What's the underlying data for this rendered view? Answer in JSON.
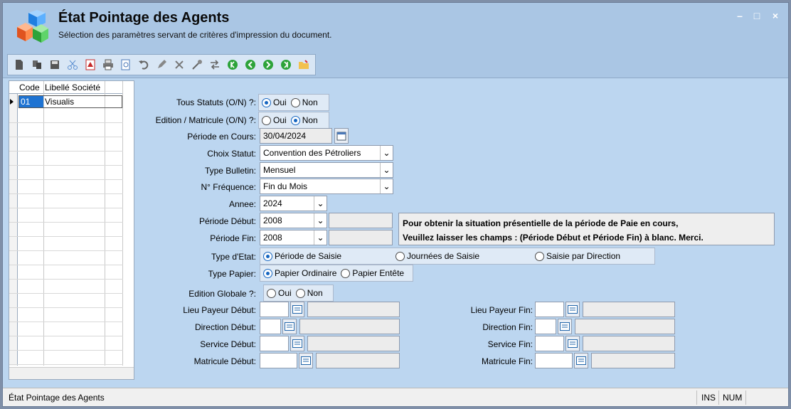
{
  "window": {
    "title": "État Pointage des Agents",
    "subtitle": "Sélection des paramètres servant de critères d'impression du document.",
    "controls": {
      "minimize": "–",
      "maximize": "□",
      "close": "×"
    }
  },
  "toolbar": {
    "icons": [
      "new-icon",
      "copy-icon",
      "save-icon",
      "scissors-icon",
      "pdf-icon",
      "print-icon",
      "preview-icon",
      "undo-icon",
      "edit-icon",
      "delete-icon",
      "tools-icon",
      "swap-icon",
      "first-icon",
      "prev-icon",
      "next-icon",
      "last-icon",
      "folder-icon"
    ]
  },
  "grid": {
    "headers": {
      "code": "Code",
      "libelle": "Libellé Société"
    },
    "rows": [
      {
        "code": "01",
        "libelle": "Visualis"
      }
    ]
  },
  "form": {
    "tous_statuts": {
      "label": "Tous Statuts (O/N) ?:",
      "oui": "Oui",
      "non": "Non",
      "selected": "Oui"
    },
    "edition_matricule": {
      "label": "Edition / Matricule (O/N) ?:",
      "oui": "Oui",
      "non": "Non",
      "selected": "Non"
    },
    "periode_en_cours": {
      "label": "Période en Cours:",
      "value": "30/04/2024"
    },
    "choix_statut": {
      "label": "Choix Statut:",
      "value": "Convention des Pétroliers"
    },
    "type_bulletin": {
      "label": "Type Bulletin:",
      "value": "Mensuel"
    },
    "frequence": {
      "label": "N° Fréquence:",
      "value": "Fin du Mois"
    },
    "annee": {
      "label": "Annee:",
      "value": "2024"
    },
    "periode_debut": {
      "label": "Période Début:",
      "value": "2008"
    },
    "periode_fin": {
      "label": "Période Fin:",
      "value": "2008"
    },
    "note_line1": "Pour obtenir la situation présentielle de la période de Paie en cours,",
    "note_line2": "Veuillez laisser les champs : (Période Début et Période Fin) à blanc. Merci.",
    "type_etat": {
      "label": "Type d'Etat:",
      "opt1": "Période de Saisie",
      "opt2": "Journées de Saisie",
      "opt3": "Saisie par Direction",
      "selected": "Période de Saisie"
    },
    "type_papier": {
      "label": "Type Papier:",
      "opt1": "Papier Ordinaire",
      "opt2": "Papier Entête",
      "selected": "Papier Ordinaire"
    },
    "edition_globale": {
      "label": "Edition Globale ?:",
      "oui": "Oui",
      "non": "Non"
    },
    "lieu_payeur_debut": "Lieu Payeur Début:",
    "lieu_payeur_fin": "Lieu Payeur Fin:",
    "direction_debut": "Direction Début:",
    "direction_fin": "Direction Fin:",
    "service_debut": "Service Début:",
    "service_fin": "Service Fin:",
    "matricule_debut": "Matricule Début:",
    "matricule_fin": "Matricule Fin:"
  },
  "statusbar": {
    "text": "État Pointage des Agents",
    "ins": "INS",
    "num": "NUM"
  }
}
